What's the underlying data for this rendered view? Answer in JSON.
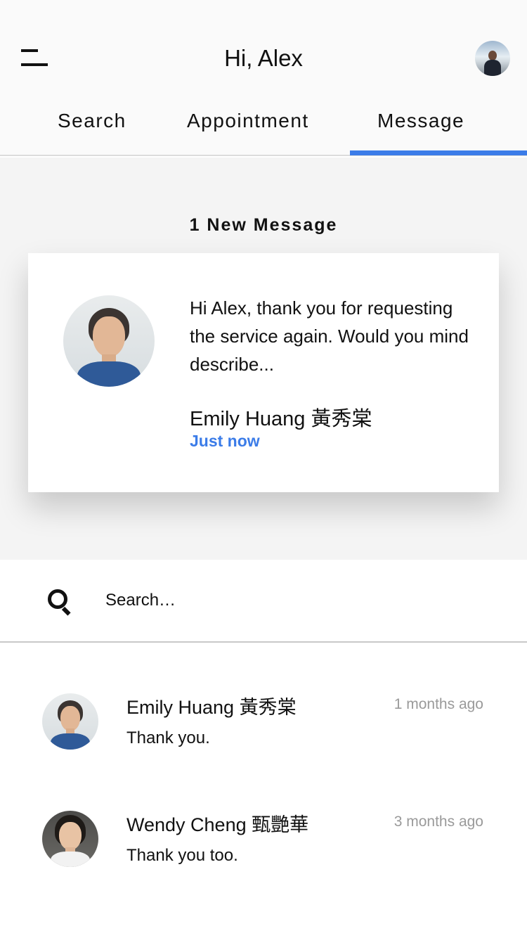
{
  "header": {
    "greeting": "Hi, Alex",
    "menu_icon": "hamburger-menu-icon",
    "avatar_label": "user-avatar"
  },
  "tabs": [
    {
      "label": "Search",
      "active": false
    },
    {
      "label": "Appointment",
      "active": false
    },
    {
      "label": "Message",
      "active": true
    }
  ],
  "accent_color": "#3b7ce8",
  "new_messages": {
    "heading": "1 New Message",
    "card": {
      "text": "Hi Alex, thank you for requesting the service again. Would you mind describe...",
      "sender": "Emily Huang  黃秀棠",
      "time": "Just now"
    }
  },
  "search": {
    "placeholder": "Search…",
    "icon": "search-icon"
  },
  "conversations": [
    {
      "name": "Emily Huang  黃秀棠",
      "time": "1 months ago",
      "preview": "Thank you."
    },
    {
      "name": "Wendy Cheng  甄艷華",
      "time": "3 months ago",
      "preview": "Thank you too."
    }
  ]
}
